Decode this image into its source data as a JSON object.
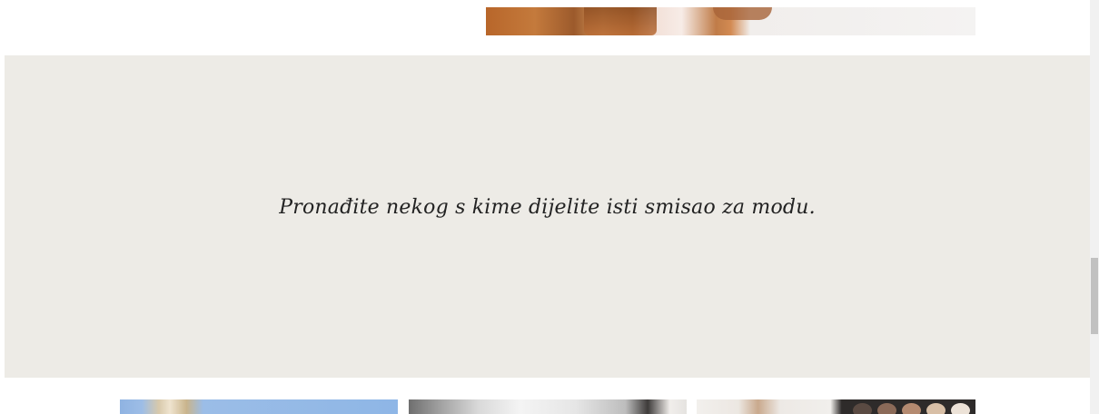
{
  "quote": {
    "text": "Pronađite nekog s kime dijelite isti smisao za modu."
  },
  "images": {
    "top": "fashion-photo",
    "gallery": [
      "fashion-photo",
      "fashion-photo",
      "makeup-palette-photo"
    ]
  },
  "colors": {
    "band_background": "#edebe6",
    "quote_text": "#222222",
    "page_background": "#ffffff"
  }
}
